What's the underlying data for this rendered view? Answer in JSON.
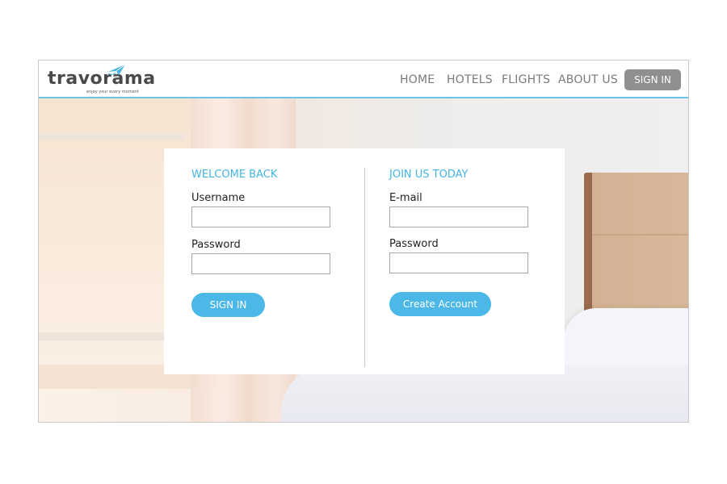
{
  "brand": {
    "name": "travorama",
    "tagline": "enjoy your every moment",
    "accent_color": "#45b5e3"
  },
  "nav": {
    "links": [
      "HOME",
      "HOTELS",
      "FLIGHTS",
      "ABOUT US"
    ],
    "signin_label": "SIGN IN"
  },
  "signin_panel": {
    "title": "WELCOME BACK",
    "username_label": "Username",
    "username_value": "",
    "password_label": "Password",
    "password_value": "",
    "button_label": "SIGN IN"
  },
  "join_panel": {
    "title": "JOIN US TODAY",
    "email_label": "E-mail",
    "email_value": "",
    "password_label": "Password",
    "password_value": "",
    "button_label": "Create Account"
  }
}
